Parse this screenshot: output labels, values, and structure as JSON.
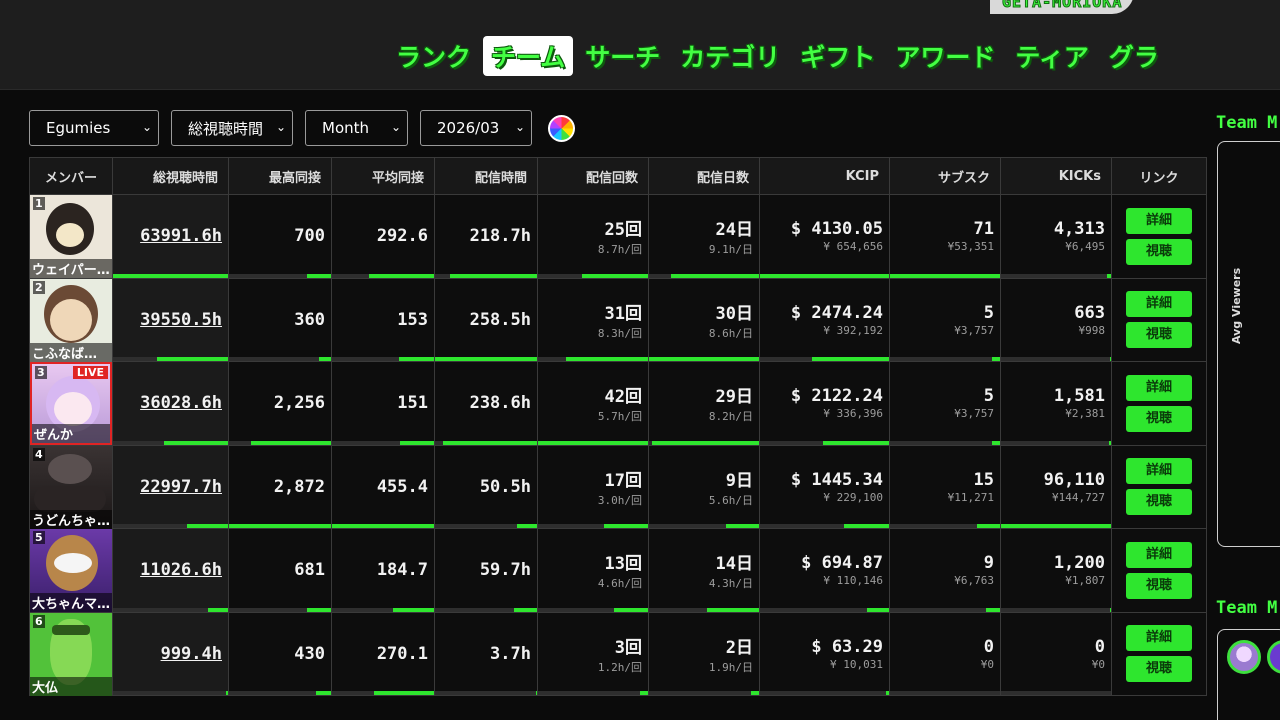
{
  "header": {
    "logo_text": "GETA-MORIOKA",
    "nav": [
      {
        "label": "ランク",
        "active": false
      },
      {
        "label": "チーム",
        "active": true
      },
      {
        "label": "サーチ",
        "active": false
      },
      {
        "label": "カテゴリ",
        "active": false
      },
      {
        "label": "ギフト",
        "active": false
      },
      {
        "label": "アワード",
        "active": false
      },
      {
        "label": "ティア",
        "active": false
      },
      {
        "label": "グラ",
        "active": false
      }
    ]
  },
  "filters": {
    "team": "Egumies",
    "metric": "総視聴時間",
    "period": "Month",
    "month": "2026/03"
  },
  "table": {
    "headers": [
      "メンバー",
      "総視聴時間",
      "最高同接",
      "平均同接",
      "配信時間",
      "配信回数",
      "配信日数",
      "KCIP",
      "サブスク",
      "KICKs",
      "リンク"
    ],
    "rows": [
      {
        "rank": "1",
        "name": "ウェイパー…",
        "live": false,
        "total": "63991.6h",
        "peak": "700",
        "avg": "292.6",
        "hours": "218.7h",
        "count": "25回",
        "count_sub": "8.7h/回",
        "days": "24日",
        "days_sub": "9.1h/日",
        "kcip": "$ 4130.05",
        "kcip_sub": "¥ 654,656",
        "subs": "71",
        "subs_sub": "¥53,351",
        "kicks": "4,313",
        "kicks_sub": "¥6,495",
        "bars": [
          1.0,
          0.24,
          0.64,
          0.85,
          0.6,
          0.8,
          1.0,
          1.0,
          0.04
        ],
        "btn_detail": "詳細",
        "btn_watch": "視聴"
      },
      {
        "rank": "2",
        "name": "こふなば…",
        "live": false,
        "total": "39550.5h",
        "peak": "360",
        "avg": "153",
        "hours": "258.5h",
        "count": "31回",
        "count_sub": "8.3h/回",
        "days": "30日",
        "days_sub": "8.6h/日",
        "kcip": "$ 2474.24",
        "kcip_sub": "¥ 392,192",
        "subs": "5",
        "subs_sub": "¥3,757",
        "kicks": "663",
        "kicks_sub": "¥998",
        "bars": [
          0.62,
          0.12,
          0.34,
          1.0,
          0.75,
          1.0,
          0.6,
          0.07,
          0.01
        ],
        "btn_detail": "詳細",
        "btn_watch": "視聴"
      },
      {
        "rank": "3",
        "name": "ぜんか",
        "live": true,
        "live_label": "LIVE",
        "total": "36028.6h",
        "peak": "2,256",
        "avg": "151",
        "hours": "238.6h",
        "count": "42回",
        "count_sub": "5.7h/回",
        "days": "29日",
        "days_sub": "8.2h/日",
        "kcip": "$ 2122.24",
        "kcip_sub": "¥ 336,396",
        "subs": "5",
        "subs_sub": "¥3,757",
        "kicks": "1,581",
        "kicks_sub": "¥2,381",
        "bars": [
          0.56,
          0.78,
          0.33,
          0.92,
          1.0,
          0.97,
          0.51,
          0.07,
          0.02
        ],
        "btn_detail": "詳細",
        "btn_watch": "視聴"
      },
      {
        "rank": "4",
        "name": "うどんちゃ…",
        "live": false,
        "total": "22997.7h",
        "peak": "2,872",
        "avg": "455.4",
        "hours": "50.5h",
        "count": "17回",
        "count_sub": "3.0h/回",
        "days": "9日",
        "days_sub": "5.6h/日",
        "kcip": "$ 1445.34",
        "kcip_sub": "¥ 229,100",
        "subs": "15",
        "subs_sub": "¥11,271",
        "kicks": "96,110",
        "kicks_sub": "¥144,727",
        "bars": [
          0.36,
          1.0,
          1.0,
          0.2,
          0.4,
          0.3,
          0.35,
          0.21,
          1.0
        ],
        "btn_detail": "詳細",
        "btn_watch": "視聴"
      },
      {
        "rank": "5",
        "name": "大ちゃんマ…",
        "live": false,
        "total": "11026.6h",
        "peak": "681",
        "avg": "184.7",
        "hours": "59.7h",
        "count": "13回",
        "count_sub": "4.6h/回",
        "days": "14日",
        "days_sub": "4.3h/日",
        "kcip": "$ 694.87",
        "kcip_sub": "¥ 110,146",
        "subs": "9",
        "subs_sub": "¥6,763",
        "kicks": "1,200",
        "kicks_sub": "¥1,807",
        "bars": [
          0.17,
          0.24,
          0.4,
          0.23,
          0.31,
          0.47,
          0.17,
          0.13,
          0.01
        ],
        "btn_detail": "詳細",
        "btn_watch": "視聴"
      },
      {
        "rank": "6",
        "name": "大仏",
        "live": false,
        "total": "999.4h",
        "peak": "430",
        "avg": "270.1",
        "hours": "3.7h",
        "count": "3回",
        "count_sub": "1.2h/回",
        "days": "2日",
        "days_sub": "1.9h/日",
        "kcip": "$ 63.29",
        "kcip_sub": "¥ 10,031",
        "subs": "0",
        "subs_sub": "¥0",
        "kicks": "0",
        "kicks_sub": "¥0",
        "bars": [
          0.02,
          0.15,
          0.59,
          0.01,
          0.07,
          0.07,
          0.02,
          0.0,
          0.0
        ],
        "btn_detail": "詳細",
        "btn_watch": "視聴"
      }
    ]
  },
  "side": {
    "title1": "Team M",
    "axis_label": "Avg Viewers",
    "title2": "Team M"
  },
  "colors": {
    "accent": "#2ee62e",
    "live": "#e02424",
    "background": "#0b0b0b"
  }
}
